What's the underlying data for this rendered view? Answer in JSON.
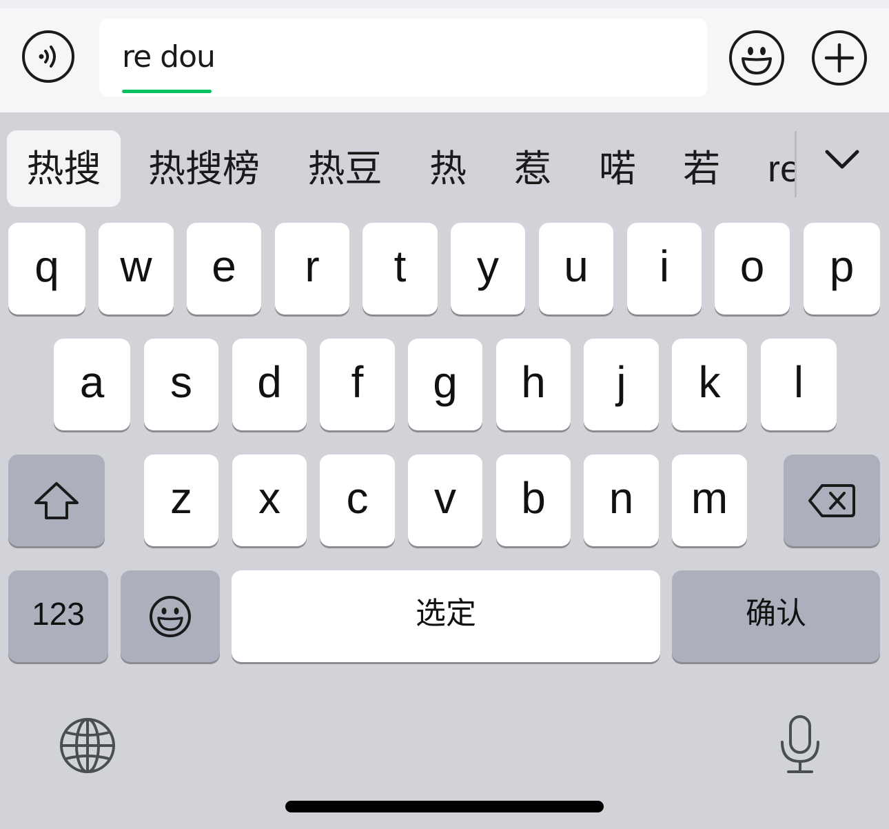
{
  "input": {
    "text": "re dou",
    "voice_icon": "voice-input-icon",
    "emoji_icon": "emoji-icon",
    "plus_icon": "plus-icon"
  },
  "candidates": [
    "热搜",
    "热搜榜",
    "热豆",
    "热",
    "惹",
    "喏",
    "若"
  ],
  "candidate_overflow": "re",
  "expand_icon": "chevron-down-icon",
  "keys": {
    "row1": [
      "q",
      "w",
      "e",
      "r",
      "t",
      "y",
      "u",
      "i",
      "o",
      "p"
    ],
    "row2": [
      "a",
      "s",
      "d",
      "f",
      "g",
      "h",
      "j",
      "k",
      "l"
    ],
    "row3": [
      "z",
      "x",
      "c",
      "v",
      "b",
      "n",
      "m"
    ],
    "shift_icon": "shift-icon",
    "backspace_icon": "backspace-icon",
    "numbers": "123",
    "emoji_icon": "emoji-icon",
    "space": "选定",
    "confirm": "确认"
  },
  "bottom": {
    "globe_icon": "globe-icon",
    "mic_icon": "microphone-icon"
  },
  "colors": {
    "accent": "#07c160",
    "keyboard_bg": "#d1d3d9",
    "dark_key": "#abb0bc"
  }
}
